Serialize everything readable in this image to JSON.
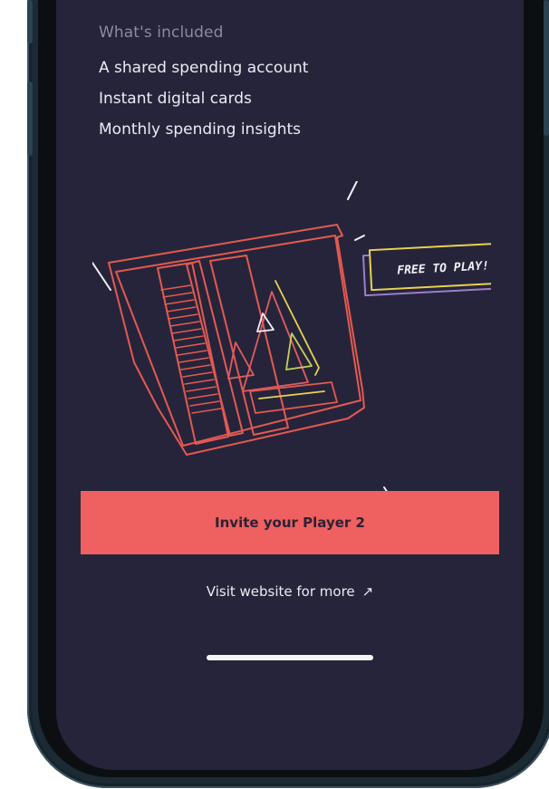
{
  "included": {
    "heading": "What's included",
    "items": [
      "A shared spending account",
      "Instant digital cards",
      "Monthly spending insights"
    ]
  },
  "illustration": {
    "sticker_text": "FREE TO PLAY!"
  },
  "actions": {
    "invite_label": "Invite your Player 2",
    "website_label": "Visit website for more",
    "website_icon": "arrow-up-right-icon"
  },
  "colors": {
    "screen_bg": "#26243a",
    "accent": "#ee6160",
    "text": "#ecebf3",
    "muted": "#8c8aa3"
  }
}
